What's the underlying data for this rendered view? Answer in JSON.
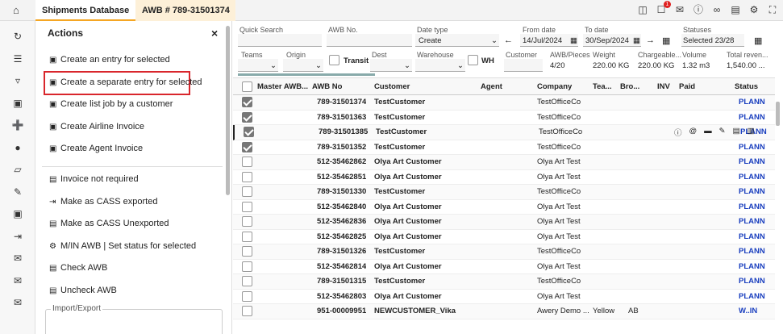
{
  "topbar": {
    "home_icon": "home-icon",
    "tabs": [
      "Shipments Database",
      "AWB # 789-31501374"
    ],
    "notification_count": "1"
  },
  "actions": {
    "title": "Actions",
    "close": "×",
    "items": [
      "Create an entry for selected",
      "Create a separate entry for selected",
      "Create list job by a customer",
      "Create Airline Invoice",
      "Create Agent Invoice",
      "Invoice not required",
      "Make as CASS exported",
      "Make as CASS Unexported",
      "M/IN AWB | Set status for selected",
      "Check AWB",
      "Uncheck AWB"
    ],
    "import_export_label": "Import/Export"
  },
  "filters": {
    "quick_search_label": "Quick Search",
    "awb_no_label": "AWB No.",
    "date_type_label": "Date type",
    "date_type_value": "Create",
    "from_date_label": "From date",
    "from_date_value": "14/Jul/2024",
    "to_date_label": "To date",
    "to_date_value": "30/Sep/2024",
    "statuses_label": "Statuses",
    "statuses_value": "Selected 23/28",
    "teams_label": "Teams",
    "origin_label": "Origin",
    "transit_label": "Transit",
    "dest_label": "Dest",
    "warehouse_label": "Warehouse",
    "wh_label": "WH",
    "customer_label": "Customer",
    "awb_pieces_label": "AWB/Pieces",
    "awb_pieces_value": "4/20",
    "weight_label": "Weight",
    "weight_value": "220.00 KG",
    "chargeable_label": "Chargeable...",
    "chargeable_value": "220.00 KG",
    "volume_label": "Volume",
    "volume_value": "1.32 m3",
    "total_rev_label": "Total reven...",
    "total_rev_value": "1,540.00 ..."
  },
  "grid": {
    "headers": [
      "Master AWB...",
      "AWB No",
      "Customer",
      "Agent",
      "Company",
      "Tea...",
      "Bro...",
      "INV",
      "Paid",
      "Status"
    ],
    "rows": [
      {
        "checked": true,
        "awb": "789-31501374",
        "customer": "TestCustomer",
        "company": "TestOfficeCo",
        "team": "",
        "bro": "",
        "status": "PLANN"
      },
      {
        "checked": true,
        "awb": "789-31501363",
        "customer": "TestCustomer",
        "company": "TestOfficeCo",
        "team": "",
        "bro": "",
        "status": "PLANN"
      },
      {
        "checked": true,
        "awb": "789-31501385",
        "customer": "TestCustomer",
        "company": "TestOfficeCo",
        "team": "",
        "bro": "",
        "status": "PLANN"
      },
      {
        "checked": true,
        "awb": "789-31501352",
        "customer": "TestCustomer",
        "company": "TestOfficeCo",
        "team": "",
        "bro": "",
        "status": "PLANN"
      },
      {
        "checked": false,
        "awb": "512-35462862",
        "customer": "Olya Art Customer",
        "company": "Olya Art Test",
        "team": "",
        "bro": "",
        "status": "PLANN"
      },
      {
        "checked": false,
        "awb": "512-35462851",
        "customer": "Olya Art Customer",
        "company": "Olya Art Test",
        "team": "",
        "bro": "",
        "status": "PLANN"
      },
      {
        "checked": false,
        "awb": "789-31501330",
        "customer": "TestCustomer",
        "company": "TestOfficeCo",
        "team": "",
        "bro": "",
        "status": "PLANN"
      },
      {
        "checked": false,
        "awb": "512-35462840",
        "customer": "Olya Art Customer",
        "company": "Olya Art Test",
        "team": "",
        "bro": "",
        "status": "PLANN"
      },
      {
        "checked": false,
        "awb": "512-35462836",
        "customer": "Olya Art Customer",
        "company": "Olya Art Test",
        "team": "",
        "bro": "",
        "status": "PLANN"
      },
      {
        "checked": false,
        "awb": "512-35462825",
        "customer": "Olya Art Customer",
        "company": "Olya Art Test",
        "team": "",
        "bro": "",
        "status": "PLANN"
      },
      {
        "checked": false,
        "awb": "789-31501326",
        "customer": "TestCustomer",
        "company": "TestOfficeCo",
        "team": "",
        "bro": "",
        "status": "PLANN"
      },
      {
        "checked": false,
        "awb": "512-35462814",
        "customer": "Olya Art Customer",
        "company": "Olya Art Test",
        "team": "",
        "bro": "",
        "status": "PLANN"
      },
      {
        "checked": false,
        "awb": "789-31501315",
        "customer": "TestCustomer",
        "company": "TestOfficeCo",
        "team": "",
        "bro": "",
        "status": "PLANN"
      },
      {
        "checked": false,
        "awb": "512-35462803",
        "customer": "Olya Art Customer",
        "company": "Olya Art Test",
        "team": "",
        "bro": "",
        "status": "PLANN"
      },
      {
        "checked": false,
        "awb": "951-00009951",
        "customer": "NEWCUSTOMER_Vika",
        "company": "Awery Demo ...",
        "team": "Yellow",
        "bro": "AB",
        "status": "W..IN"
      }
    ]
  },
  "colors": {
    "accent": "#f5a623",
    "highlight": "#d9262c",
    "status": "#1a3fbf"
  }
}
